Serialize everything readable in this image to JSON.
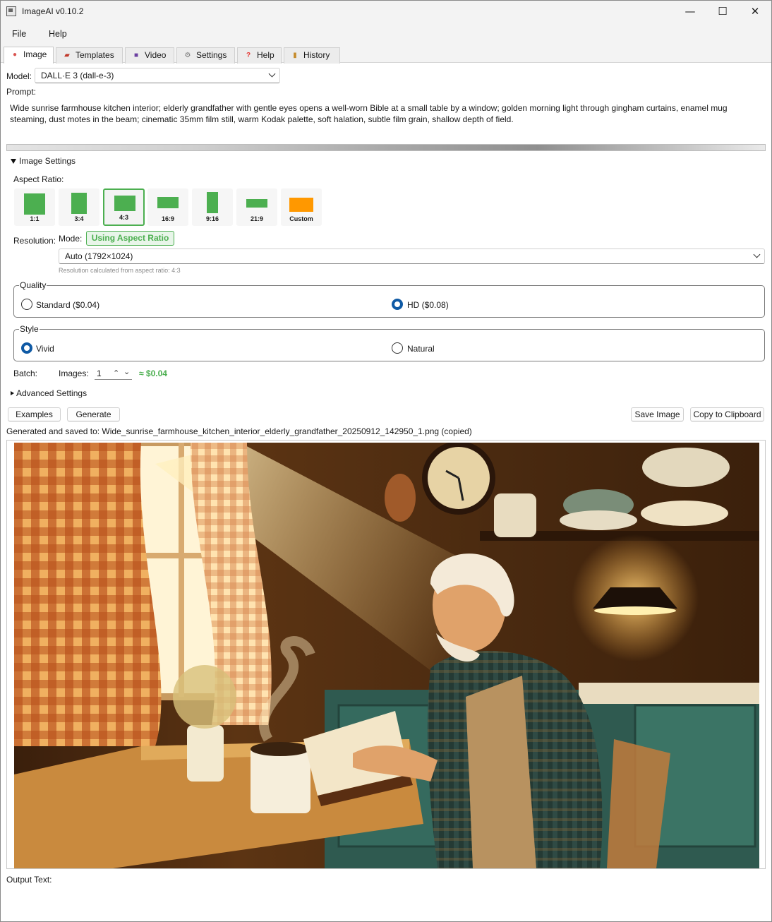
{
  "window": {
    "title": "ImageAI v0.10.2",
    "controls": {
      "minimize": "—",
      "maximize": "☐",
      "close": "✕"
    }
  },
  "menu": {
    "file": "File",
    "help": "Help"
  },
  "tabs": [
    {
      "label": "Image",
      "icon": "palette-icon",
      "active": true
    },
    {
      "label": "Templates",
      "icon": "book-icon"
    },
    {
      "label": "Video",
      "icon": "clapper-icon"
    },
    {
      "label": "Settings",
      "icon": "gear-icon"
    },
    {
      "label": "Help",
      "icon": "question-icon"
    },
    {
      "label": "History",
      "icon": "scroll-icon"
    }
  ],
  "model": {
    "label": "Model:",
    "value": "DALL·E 3 (dall-e-3)"
  },
  "prompt": {
    "label": "Prompt:",
    "text": "Wide sunrise farmhouse kitchen interior; elderly grandfather with gentle eyes opens a well-worn Bible at a small table by a window; golden morning light through gingham curtains, enamel mug steaming, dust motes in the beam; cinematic 35mm film still, warm Kodak palette, soft halation, subtle film grain, shallow depth of field."
  },
  "image_settings": {
    "header": "Image Settings",
    "aspect_ratio_label": "Aspect Ratio:",
    "aspect_ratios": [
      {
        "label": "1:1"
      },
      {
        "label": "3:4"
      },
      {
        "label": "4:3",
        "selected": true
      },
      {
        "label": "16:9"
      },
      {
        "label": "9:16"
      },
      {
        "label": "21:9"
      },
      {
        "label": "Custom"
      }
    ],
    "resolution": {
      "label": "Resolution:",
      "mode_label": "Mode:",
      "mode_button": "Using Aspect Ratio",
      "value": "Auto (1792×1024)",
      "hint": "Resolution calculated from aspect ratio: 4:3"
    },
    "quality": {
      "title": "Quality",
      "options": [
        {
          "label": "Standard ($0.04)",
          "checked": false
        },
        {
          "label": "HD ($0.08)",
          "checked": true
        }
      ]
    },
    "style": {
      "title": "Style",
      "options": [
        {
          "label": "Vivid",
          "checked": true
        },
        {
          "label": "Natural",
          "checked": false
        }
      ]
    },
    "batch": {
      "label": "Batch:",
      "images_label": "Images:",
      "count": "1",
      "cost": "≈ $0.04"
    }
  },
  "advanced": {
    "label": "Advanced Settings"
  },
  "actions": {
    "examples": "Examples",
    "generate": "Generate",
    "save_image": "Save Image",
    "copy": "Copy to Clipboard"
  },
  "status": "Generated and saved to: Wide_sunrise_farmhouse_kitchen_interior_elderly_grandfather_20250912_142950_1.png (copied)",
  "output_label": "Output Text:",
  "colors": {
    "accent_green": "#4caf50",
    "custom_orange": "#ff9800",
    "radio_blue": "#0f5aa5"
  }
}
